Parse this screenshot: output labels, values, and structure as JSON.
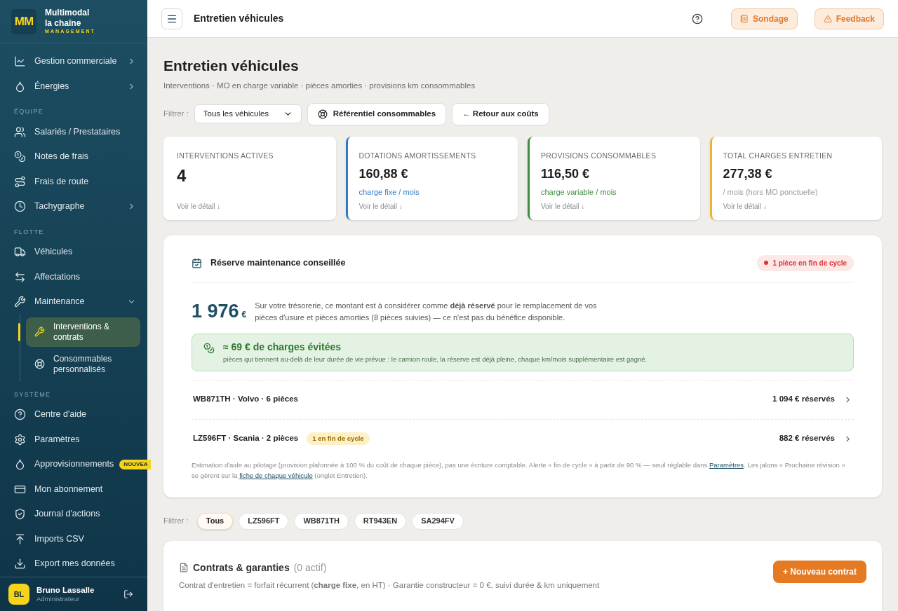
{
  "brand": {
    "logo": "MM",
    "line1": "Multimodal",
    "line2": "la chaîne",
    "line3": "MANAGEMENT"
  },
  "sidebar": {
    "sections": [
      {
        "items": [
          {
            "label": "Gestion commerciale",
            "expanded": false
          },
          {
            "label": "Énergies",
            "expanded": false
          }
        ]
      },
      {
        "title": "ÉQUIPE",
        "items": [
          {
            "label": "Salariés / Prestataires"
          },
          {
            "label": "Notes de frais"
          },
          {
            "label": "Frais de route"
          },
          {
            "label": "Tachygraphe",
            "expanded": false
          }
        ]
      },
      {
        "title": "FLOTTE",
        "items": [
          {
            "label": "Véhicules"
          },
          {
            "label": "Affectations"
          },
          {
            "label": "Maintenance",
            "expanded": true,
            "children": [
              {
                "label": "Interventions & contrats",
                "selected": true
              },
              {
                "label": "Consommables personnalisés",
                "selected": false
              }
            ]
          }
        ]
      },
      {
        "title": "SYSTÈME",
        "items": [
          {
            "label": "Centre d'aide"
          },
          {
            "label": "Paramètres"
          },
          {
            "label": "Approvisionnements",
            "badge": "NOUVEA"
          },
          {
            "label": "Mon abonnement"
          },
          {
            "label": "Journal d'actions"
          },
          {
            "label": "Imports CSV"
          },
          {
            "label": "Export mes données"
          }
        ]
      }
    ]
  },
  "user": {
    "initials": "BL",
    "name": "Bruno Lassalle",
    "role": "Administrateur"
  },
  "topbar": {
    "title": "Entretien véhicules",
    "buttons": [
      "Sondage",
      "Feedback"
    ]
  },
  "page": {
    "title": "Entretien véhicules",
    "subtitle": "Interventions · MO en charge variable · pièces amorties · provisions km consommables",
    "filter_label": "Filtrer :",
    "vehicle_select": "Tous les véhicules",
    "actions": [
      "Référentiel consommables",
      "← Retour aux coûts"
    ]
  },
  "stats": [
    {
      "label": "INTERVENTIONS ACTIVES",
      "value": "4",
      "link": "Voir le détail ↓"
    },
    {
      "label": "DOTATIONS AMORTISSEMENTS",
      "value": "160,88 €",
      "note": "charge fixe / mois",
      "color": "#2f7cc4",
      "link": "Voir le détail ↓"
    },
    {
      "label": "PROVISIONS CONSOMMABLES",
      "value": "116,50 €",
      "note": "charge variable / mois",
      "color": "#3d8b3d",
      "link": "Voir le détail ↓"
    },
    {
      "label": "TOTAL CHARGES ENTRETIEN",
      "value": "277,38 €",
      "note": "/ mois (hors MO ponctuelle)",
      "color": "#f0b232",
      "link": "Voir le détail ↓"
    }
  ],
  "reserve": {
    "title": "Réserve maintenance conseillée",
    "alert": "1 pièce en fin de cycle",
    "amount": "1 976",
    "currency": "€",
    "explanation": "Sur votre trésorerie, ce montant est à considérer comme **déjà réservé** pour le remplacement de vos pièces d'usure et pièces amorties (8 pièces suivies) — ce n'est pas du bénéfice disponible.",
    "savings": {
      "title": "≈ 69 € de charges évitées",
      "text": "pièces qui tiennent au-delà de leur durée de vie prévue : le camion roule, la réserve est déjà pleine, chaque km/mois supplémentaire est gagné."
    },
    "vehicles": [
      {
        "name": "WB871TH · Volvo · 6 pièces",
        "amount": "1 094 € réservés"
      },
      {
        "name": "LZ596FT · Scania · 2 pièces",
        "tag": "1 en fin de cycle",
        "amount": "882 € réservés"
      }
    ],
    "footnote": [
      {
        "kind": "text",
        "text": "Estimation d'aide au pilotage (provision plafonnée à 100 % du coût de chaque pièce), pas une écriture comptable. Alerte « fin de cycle » à partir de 90 % — seuil réglable dans "
      },
      {
        "kind": "link",
        "text": "Paramètres"
      },
      {
        "kind": "text",
        "text": ". Les jalons « Prochaine révision » se gèrent sur la "
      },
      {
        "kind": "link",
        "text": "fiche de chaque véhicule"
      },
      {
        "kind": "text",
        "text": " (onglet Entretien)."
      }
    ]
  },
  "vehicle_filter": {
    "label": "Filtrer :",
    "chips": [
      {
        "label": "Tous",
        "selected": true
      },
      {
        "label": "LZ596FT",
        "selected": false
      },
      {
        "label": "WB871TH",
        "selected": false
      },
      {
        "label": "RT943EN",
        "selected": false
      },
      {
        "label": "SA294FV",
        "selected": false
      }
    ]
  },
  "contracts": {
    "title": "Contrats & garanties",
    "count": "(0 actif)",
    "description": "Contrat d'entretien = forfait récurrent (**charge fixe**, en HT) · Garantie constructeur = 0 €, suivi durée & km uniquement",
    "button": "+ Nouveau contrat"
  }
}
